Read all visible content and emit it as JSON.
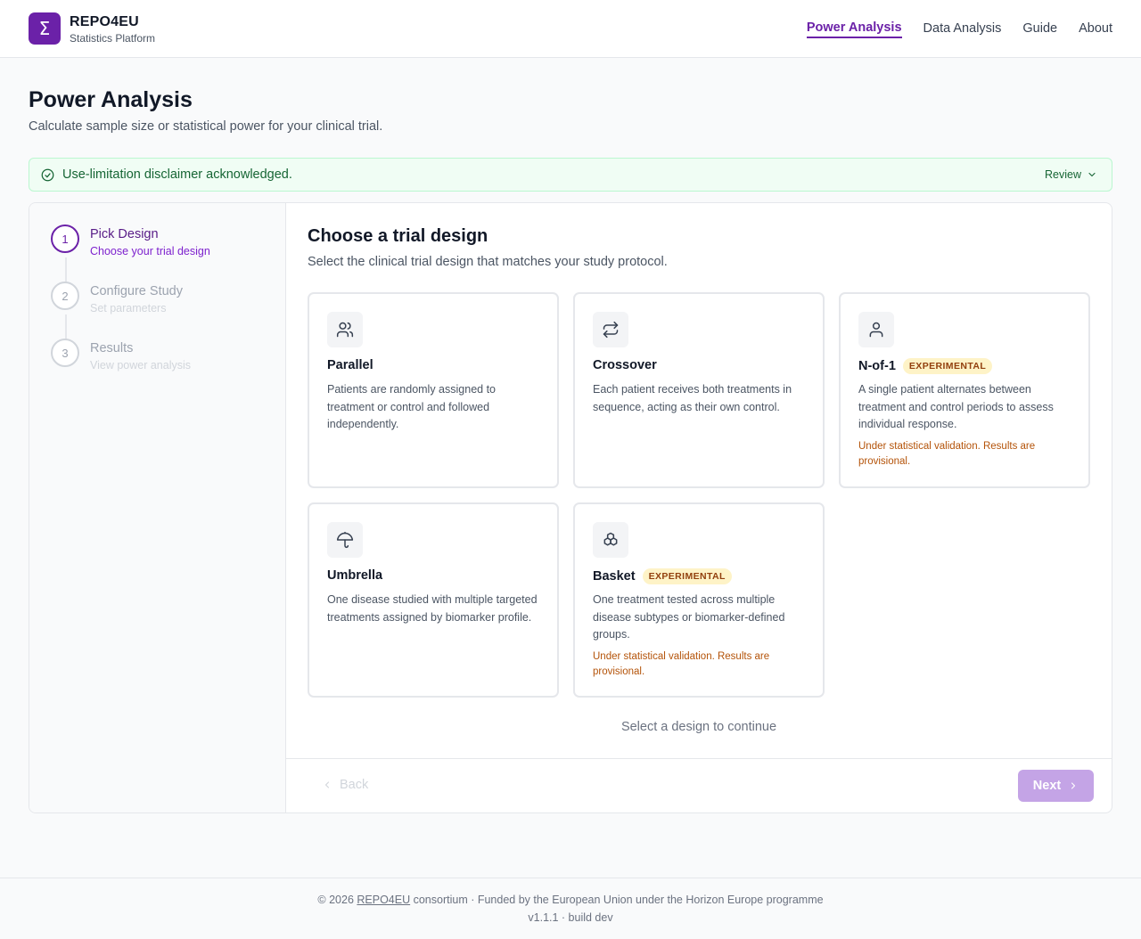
{
  "brand": {
    "logo_glyph": "Σ",
    "name": "REPO4EU",
    "subtitle": "Statistics Platform"
  },
  "nav": {
    "items": [
      "Power Analysis",
      "Data Analysis",
      "Guide",
      "About"
    ],
    "active": "Power Analysis"
  },
  "page": {
    "title": "Power Analysis",
    "subtitle": "Calculate sample size or statistical power for your clinical trial."
  },
  "disclaimer": {
    "text": "Use-limitation disclaimer acknowledged.",
    "review_label": "Review",
    "icon": "check-circle-icon"
  },
  "steps": [
    {
      "number": "1",
      "title": "Pick Design",
      "subtitle": "Choose your trial design",
      "state": "active"
    },
    {
      "number": "2",
      "title": "Configure Study",
      "subtitle": "Set parameters",
      "state": "pending"
    },
    {
      "number": "3",
      "title": "Results",
      "subtitle": "View power analysis",
      "state": "pending"
    }
  ],
  "content": {
    "title": "Choose a trial design",
    "subtitle": "Select the clinical trial design that matches your study protocol.",
    "select_hint": "Select a design to continue"
  },
  "designs": [
    {
      "title": "Parallel",
      "icon": "users-icon",
      "description": "Patients are randomly assigned to treatment or control and followed independently.",
      "badge": "",
      "warning": ""
    },
    {
      "title": "Crossover",
      "icon": "repeat-icon",
      "description": "Each patient receives both treatments in sequence, acting as their own control.",
      "badge": "",
      "warning": ""
    },
    {
      "title": "N-of-1",
      "icon": "user-icon",
      "description": "A single patient alternates between treatment and control periods to assess individual response.",
      "badge": "EXPERIMENTAL",
      "warning": "Under statistical validation. Results are provisional."
    },
    {
      "title": "Umbrella",
      "icon": "umbrella-icon",
      "description": "One disease studied with multiple targeted treatments assigned by biomarker profile.",
      "badge": "",
      "warning": ""
    },
    {
      "title": "Basket",
      "icon": "boxes-icon",
      "description": "One treatment tested across multiple disease subtypes or biomarker-defined groups.",
      "badge": "EXPERIMENTAL",
      "warning": "Under statistical validation. Results are provisional."
    }
  ],
  "buttons": {
    "back": "Back",
    "next": "Next"
  },
  "footer": {
    "prefix": "© 2026 ",
    "link": "REPO4EU",
    "suffix": " consortium · Funded by the European Union under the Horizon Europe programme",
    "version": "v1.1.1 · build dev"
  },
  "colors": {
    "accent": "#6b21a8",
    "success_bg": "#f0fdf4",
    "success_text": "#166534",
    "badge_bg": "#fef3c7",
    "warning_text": "#b45309"
  }
}
